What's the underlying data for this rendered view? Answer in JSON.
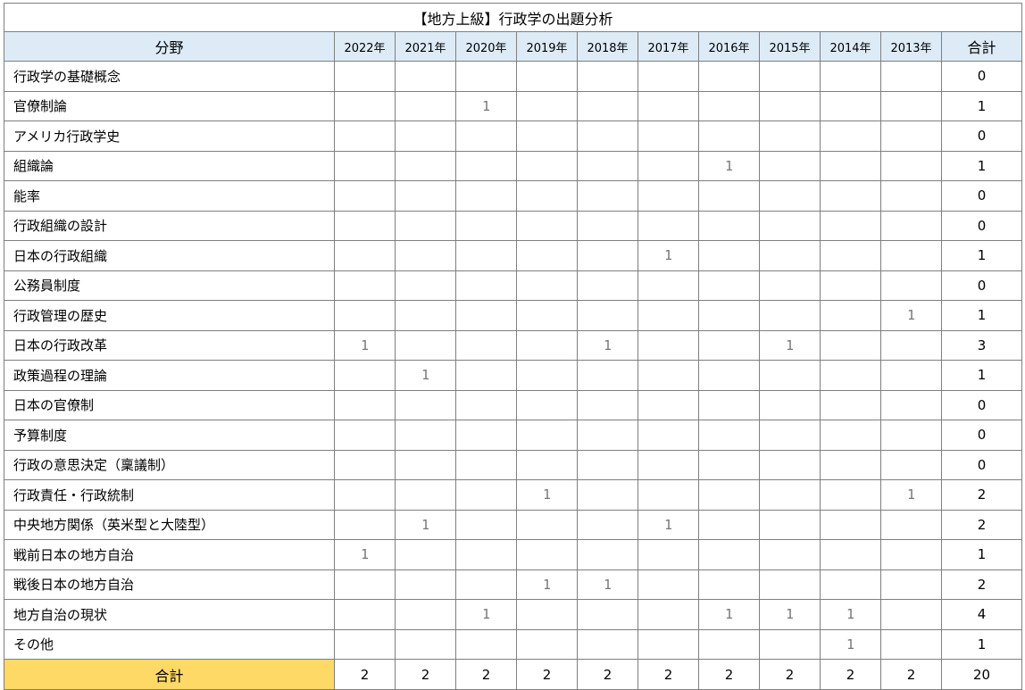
{
  "title": "【地方上級】行政学の出題分析",
  "headers": {
    "field": "分野",
    "years": [
      "2022年",
      "2021年",
      "2020年",
      "2019年",
      "2018年",
      "2017年",
      "2016年",
      "2015年",
      "2014年",
      "2013年"
    ],
    "total": "合計"
  },
  "rows": [
    {
      "field": "行政学の基礎概念",
      "cells": [
        "",
        "",
        "",
        "",
        "",
        "",
        "",
        "",
        "",
        ""
      ],
      "total": "0"
    },
    {
      "field": "官僚制論",
      "cells": [
        "",
        "",
        "1",
        "",
        "",
        "",
        "",
        "",
        "",
        ""
      ],
      "total": "1"
    },
    {
      "field": "アメリカ行政学史",
      "cells": [
        "",
        "",
        "",
        "",
        "",
        "",
        "",
        "",
        "",
        ""
      ],
      "total": "0"
    },
    {
      "field": "組織論",
      "cells": [
        "",
        "",
        "",
        "",
        "",
        "",
        "1",
        "",
        "",
        ""
      ],
      "total": "1"
    },
    {
      "field": "能率",
      "cells": [
        "",
        "",
        "",
        "",
        "",
        "",
        "",
        "",
        "",
        ""
      ],
      "total": "0"
    },
    {
      "field": "行政組織の設計",
      "cells": [
        "",
        "",
        "",
        "",
        "",
        "",
        "",
        "",
        "",
        ""
      ],
      "total": "0"
    },
    {
      "field": "日本の行政組織",
      "cells": [
        "",
        "",
        "",
        "",
        "",
        "1",
        "",
        "",
        "",
        ""
      ],
      "total": "1"
    },
    {
      "field": "公務員制度",
      "cells": [
        "",
        "",
        "",
        "",
        "",
        "",
        "",
        "",
        "",
        ""
      ],
      "total": "0"
    },
    {
      "field": "行政管理の歴史",
      "cells": [
        "",
        "",
        "",
        "",
        "",
        "",
        "",
        "",
        "",
        "1"
      ],
      "total": "1"
    },
    {
      "field": "日本の行政改革",
      "cells": [
        "1",
        "",
        "",
        "",
        "1",
        "",
        "",
        "1",
        "",
        ""
      ],
      "total": "3"
    },
    {
      "field": "政策過程の理論",
      "cells": [
        "",
        "1",
        "",
        "",
        "",
        "",
        "",
        "",
        "",
        ""
      ],
      "total": "1"
    },
    {
      "field": "日本の官僚制",
      "cells": [
        "",
        "",
        "",
        "",
        "",
        "",
        "",
        "",
        "",
        ""
      ],
      "total": "0"
    },
    {
      "field": "予算制度",
      "cells": [
        "",
        "",
        "",
        "",
        "",
        "",
        "",
        "",
        "",
        ""
      ],
      "total": "0"
    },
    {
      "field": "行政の意思決定（稟議制）",
      "cells": [
        "",
        "",
        "",
        "",
        "",
        "",
        "",
        "",
        "",
        ""
      ],
      "total": "0"
    },
    {
      "field": "行政責任・行政統制",
      "cells": [
        "",
        "",
        "",
        "1",
        "",
        "",
        "",
        "",
        "",
        "1"
      ],
      "total": "2"
    },
    {
      "field": "中央地方関係（英米型と大陸型）",
      "cells": [
        "",
        "1",
        "",
        "",
        "",
        "1",
        "",
        "",
        "",
        ""
      ],
      "total": "2"
    },
    {
      "field": "戦前日本の地方自治",
      "cells": [
        "1",
        "",
        "",
        "",
        "",
        "",
        "",
        "",
        "",
        ""
      ],
      "total": "1"
    },
    {
      "field": "戦後日本の地方自治",
      "cells": [
        "",
        "",
        "",
        "1",
        "1",
        "",
        "",
        "",
        "",
        ""
      ],
      "total": "2"
    },
    {
      "field": "地方自治の現状",
      "cells": [
        "",
        "",
        "1",
        "",
        "",
        "",
        "1",
        "1",
        "1",
        ""
      ],
      "total": "4"
    },
    {
      "field": "その他",
      "cells": [
        "",
        "",
        "",
        "",
        "",
        "",
        "",
        "",
        "1",
        ""
      ],
      "total": "1"
    }
  ],
  "footer": {
    "label": "合計",
    "cells": [
      "2",
      "2",
      "2",
      "2",
      "2",
      "2",
      "2",
      "2",
      "2",
      "2"
    ],
    "total": "20"
  },
  "colors": {
    "header_bg": "#ddebf7",
    "footer_label_bg": "#ffd966",
    "grid": "#7f7f7f"
  }
}
